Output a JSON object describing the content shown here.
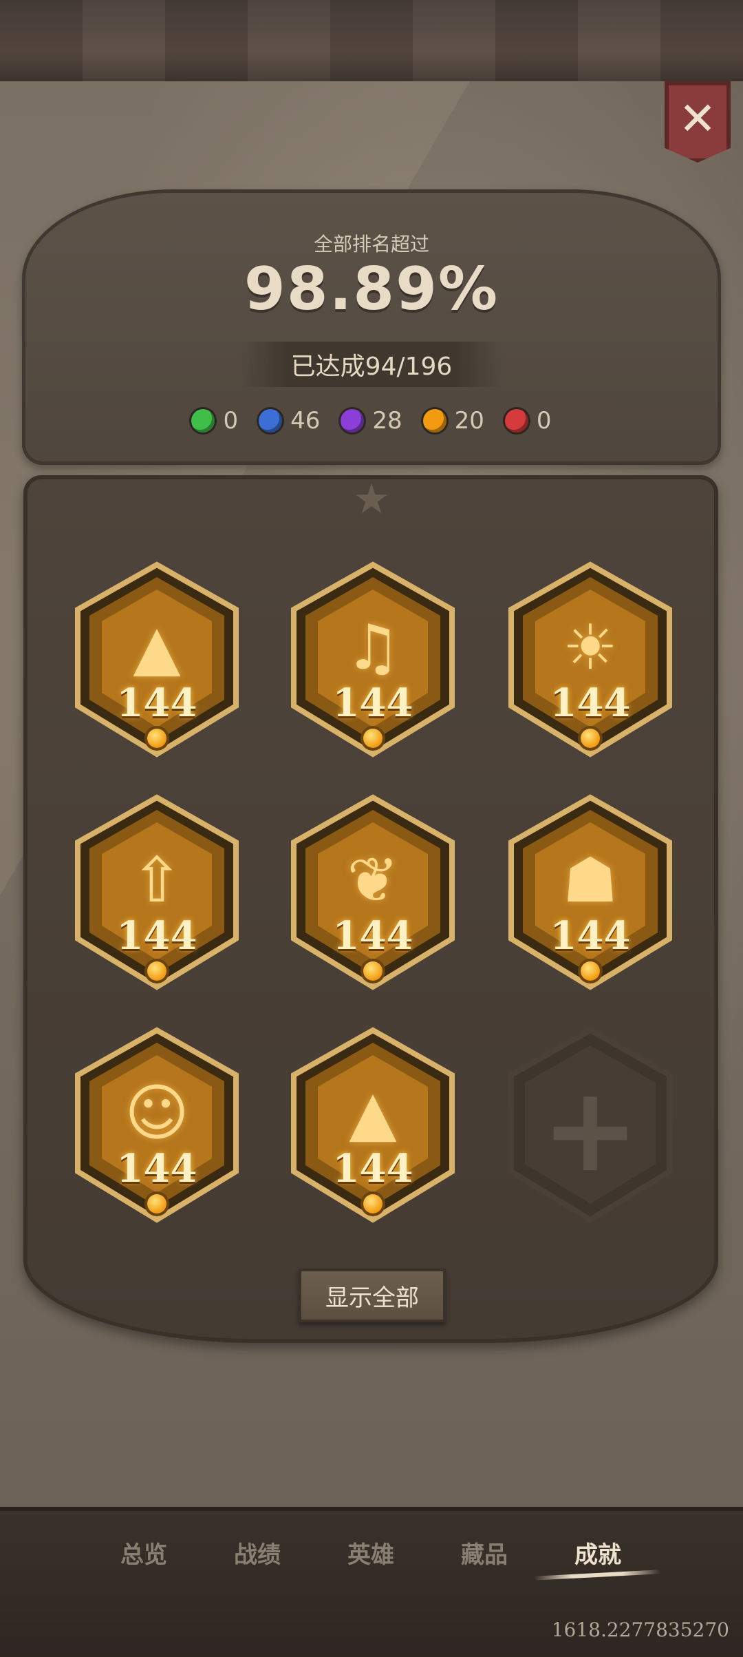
{
  "header": {
    "close_label": "✕",
    "rank_label": "全部排名超过",
    "rank_value": "98.89%",
    "achieved_text": "已达成94/196"
  },
  "gem_counts": [
    {
      "name": "green-gem-icon",
      "color": "#3fbf4a",
      "count": "0"
    },
    {
      "name": "blue-gem-icon",
      "color": "#3b6fd6",
      "count": "46"
    },
    {
      "name": "purple-gem-icon",
      "color": "#8b3fd6",
      "count": "28"
    },
    {
      "name": "orange-gem-icon",
      "color": "#f29a10",
      "count": "20"
    },
    {
      "name": "red-gem-icon",
      "color": "#d63b3b",
      "count": "0"
    }
  ],
  "badges": [
    {
      "icon": "mountain-icon",
      "glyph": "▲",
      "level": "144"
    },
    {
      "icon": "music-record-icon",
      "glyph": "♫",
      "level": "144"
    },
    {
      "icon": "sun-face-icon",
      "glyph": "☀",
      "level": "144"
    },
    {
      "icon": "rocket-icon",
      "glyph": "⇧",
      "level": "144"
    },
    {
      "icon": "beast-icon",
      "glyph": "❦",
      "level": "144"
    },
    {
      "icon": "robot-icon",
      "glyph": "☗",
      "level": "144"
    },
    {
      "icon": "girl-face-icon",
      "glyph": "☺",
      "level": "144"
    },
    {
      "icon": "mountain-icon",
      "glyph": "▲",
      "level": "144"
    }
  ],
  "add_slot_label": "+",
  "show_all_label": "显示全部",
  "tabs": [
    {
      "label": "总览"
    },
    {
      "label": "战绩"
    },
    {
      "label": "英雄"
    },
    {
      "label": "藏品"
    },
    {
      "label": "成就",
      "active": true
    }
  ],
  "footer_readout": "1618.2277835270",
  "colors": {
    "badge_gold": "#f2b13a",
    "badge_frame": "#d9b26a",
    "panel": "#756a5e"
  }
}
